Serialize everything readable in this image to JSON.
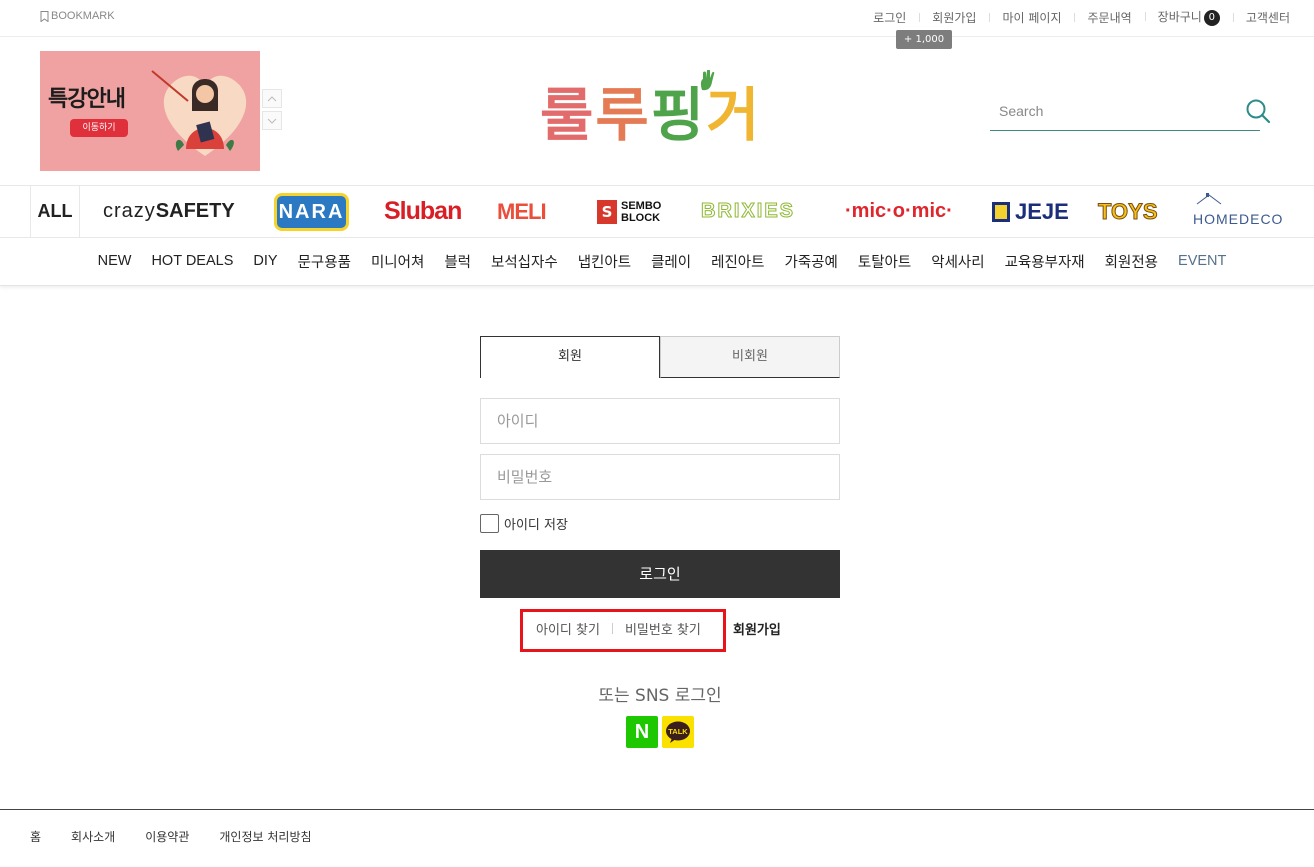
{
  "topbar": {
    "bookmark": "BOOKMARK",
    "links": [
      "로그인",
      "회원가입",
      "마이 페이지",
      "주문내역",
      "장바구니",
      "고객센터"
    ],
    "cart_count": "0",
    "join_reward": "+ 1,000"
  },
  "banner": {
    "title": "특강안내",
    "button": "이동하기"
  },
  "logo": {
    "chars": [
      "룰",
      "루",
      "핑",
      "거"
    ],
    "colors": [
      "#e26b6b",
      "#e47b54",
      "#4fa34a",
      "#f0b531"
    ]
  },
  "search": {
    "placeholder": "Search"
  },
  "brands": {
    "all": "ALL",
    "crazy_a": "crazy",
    "crazy_b": "SAFETY",
    "nara": "NARA",
    "sluban": "Sluban",
    "meli": "MELI",
    "sembo_icon": "S",
    "sembo_1": "SEMBO",
    "sembo_2": "BLOCK",
    "brixies": "BRIXIES",
    "micomic": "·mic·o·mic·",
    "jeje": "JEJE",
    "toys": "TOYS",
    "homedeco": "HOMEDECO"
  },
  "categories": [
    "NEW",
    "HOT DEALS",
    "DIY",
    "문구용품",
    "미니어쳐",
    "블럭",
    "보석십자수",
    "냅킨아트",
    "클레이",
    "레진아트",
    "가죽공예",
    "토탈아트",
    "악세사리",
    "교육용부자재",
    "회원전용",
    "EVENT"
  ],
  "login": {
    "tab_member": "회원",
    "tab_guest": "비회원",
    "id_placeholder": "아이디",
    "pw_placeholder": "비밀번호",
    "save_id": "아이디 저장",
    "login_button": "로그인",
    "find_id": "아이디 찾기",
    "find_pw": "비밀번호 찾기",
    "join": "회원가입",
    "sns_title": "또는 SNS 로그인",
    "naver": "N",
    "kakao": "TALK"
  },
  "footer": {
    "links": [
      "홈",
      "회사소개",
      "이용약관",
      "개인정보 처리방침"
    ]
  },
  "colors": {
    "login_button": "#333333",
    "highlight_box": "#e8141c",
    "naver": "#1ec800",
    "kakao": "#fae100",
    "search_underline": "#3f8a86"
  }
}
